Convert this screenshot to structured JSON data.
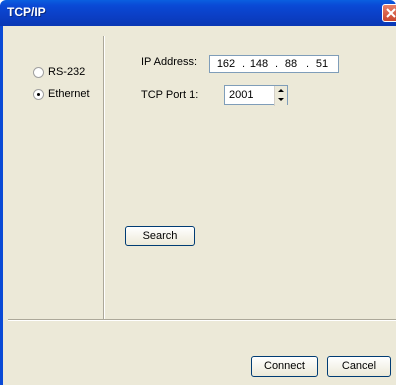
{
  "window": {
    "title": "TCP/IP"
  },
  "connection": {
    "options": [
      {
        "label": "RS-232",
        "selected": false
      },
      {
        "label": "Ethernet",
        "selected": true
      }
    ]
  },
  "settings": {
    "ip_label": "IP Address:",
    "ip_parts": [
      "162",
      "148",
      "88",
      "51"
    ],
    "ip_separator": ".",
    "port_label": "TCP Port 1:",
    "port_value": "2001"
  },
  "actions": {
    "search_label": "Search",
    "connect_label": "Connect",
    "cancel_label": "Cancel"
  }
}
